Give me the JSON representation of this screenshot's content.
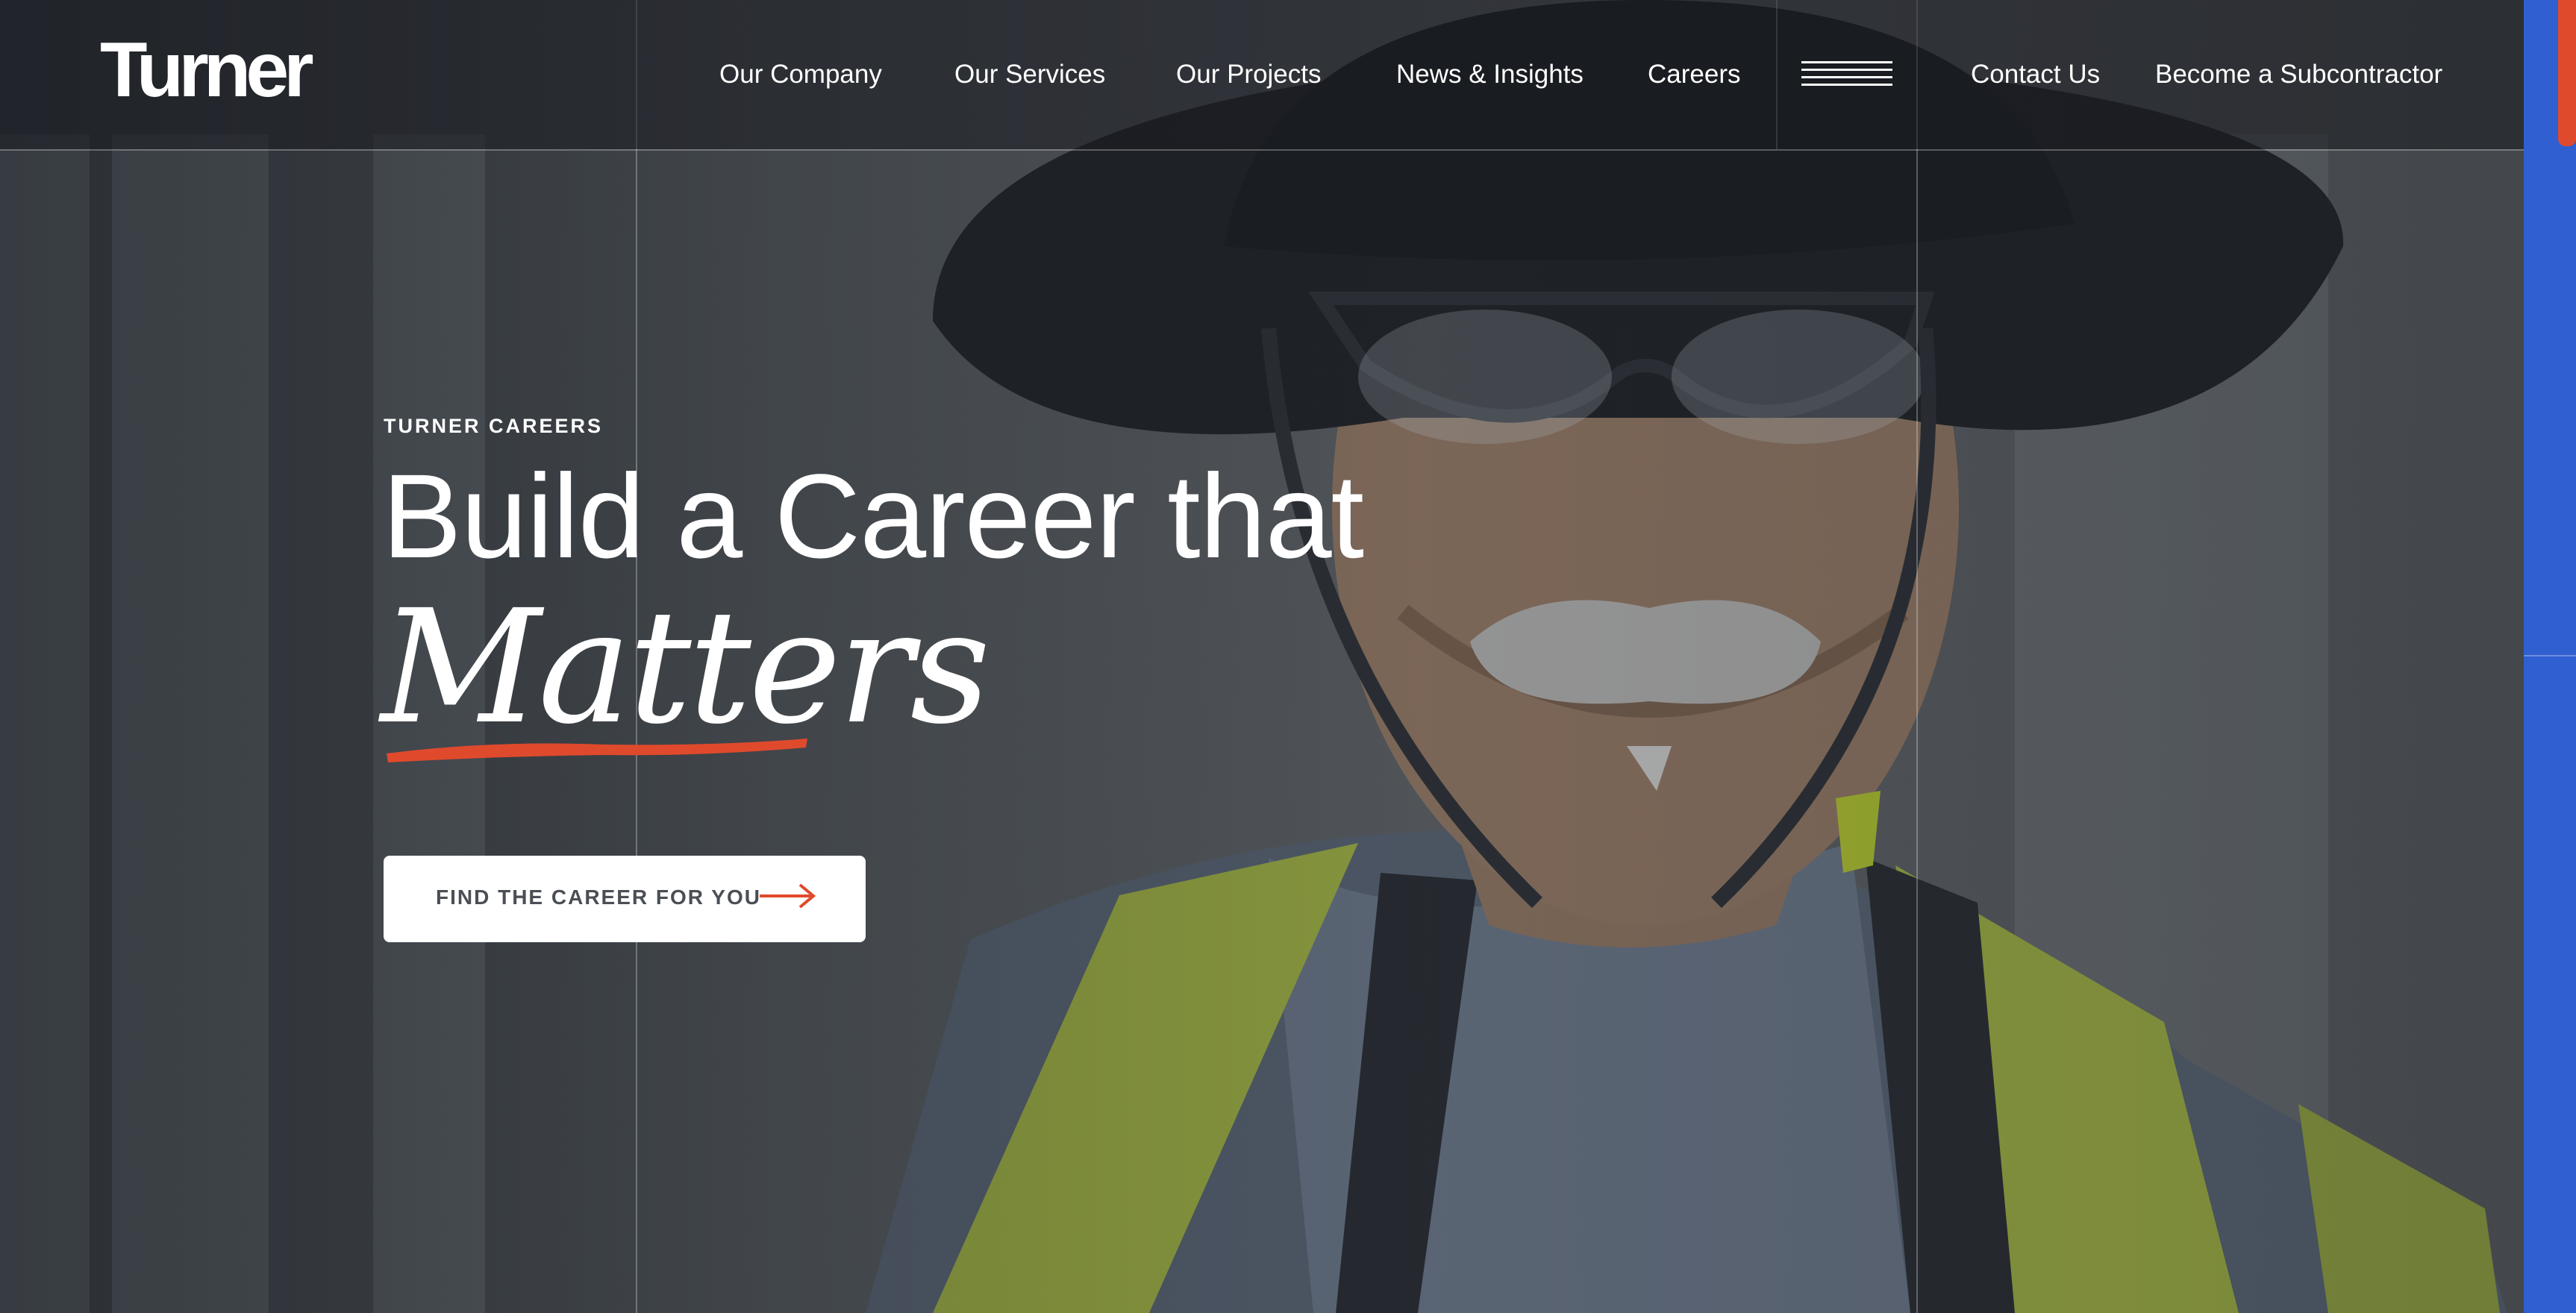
{
  "header": {
    "logo": "Turner",
    "nav": [
      {
        "label": "Our Company"
      },
      {
        "label": "Our Services"
      },
      {
        "label": "Our Projects"
      },
      {
        "label": "News & Insights"
      },
      {
        "label": "Careers"
      }
    ],
    "menu_icon": "hamburger-menu-icon",
    "contact": "Contact Us",
    "subcontractor": "Become a Subcontractor"
  },
  "hero": {
    "eyebrow": "TURNER CAREERS",
    "headline": "Build a Career that",
    "script_word": "Matters",
    "cta_label": "FIND THE CAREER FOR YOU",
    "cta_icon": "arrow-right-icon",
    "image_subject": "construction-worker-photo"
  },
  "colors": {
    "accent": "#e04a2c",
    "scrollbar_track": "#2f5fd0",
    "header_bg": "#191c21",
    "text": "#ffffff",
    "cta_text": "#4a4f55"
  }
}
